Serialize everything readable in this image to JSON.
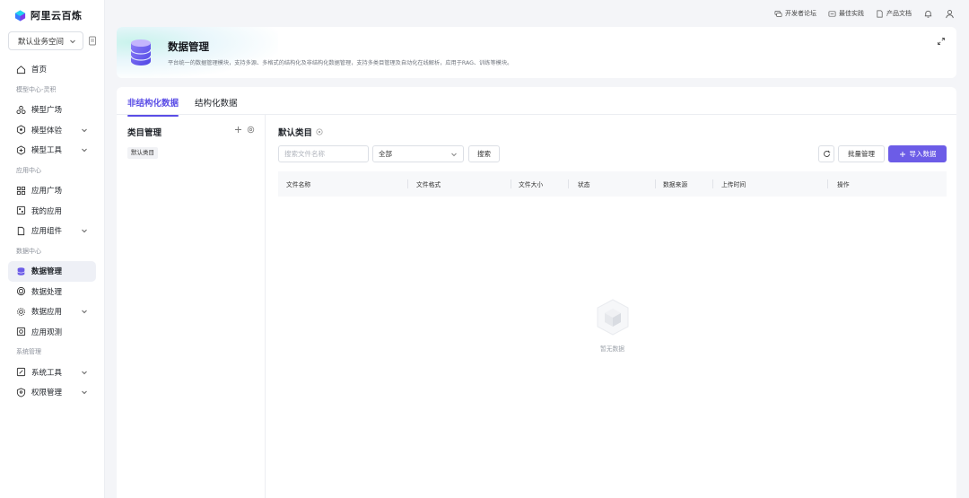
{
  "brand": {
    "name": "阿里云百炼"
  },
  "workspace": {
    "selected": "默认业务空间"
  },
  "nav": {
    "home": "首页",
    "group_model": "模型中心-灵积",
    "model_square": "模型广场",
    "model_experience": "模型体验",
    "model_tools": "模型工具",
    "group_app": "应用中心",
    "app_square": "应用广场",
    "my_apps": "我的应用",
    "app_components": "应用组件",
    "group_data": "数据中心",
    "data_management": "数据管理",
    "data_processing": "数据处理",
    "data_apps": "数据应用",
    "app_observation": "应用观测",
    "group_system": "系统管理",
    "system_tools": "系统工具",
    "permission_management": "权限管理"
  },
  "topbar": {
    "dev_forum": "开发者论坛",
    "best_practice": "最佳实践",
    "product_docs": "产品文档"
  },
  "hero": {
    "title": "数据管理",
    "description": "平台统一的数据管理模块，支持多源、多格式的结构化及非结构化数据管理，支持多类目管理及自动化在线解析，应用于RAG、训练等模块。"
  },
  "tabs": {
    "unstructured": "非结构化数据",
    "structured": "结构化数据"
  },
  "category": {
    "title": "类目管理",
    "default_item": "默认类目"
  },
  "list": {
    "title": "默认类目",
    "search_placeholder": "搜索文件名称",
    "filter_value": "全部",
    "search_button": "搜索",
    "batch_button": "批量管理",
    "import_button": "导入数据",
    "columns": [
      "文件名称",
      "文件格式",
      "文件大小",
      "状态",
      "数据来源",
      "上传时间",
      "操作"
    ],
    "empty_text": "暂无数据"
  },
  "colors": {
    "accent": "#6c5ce7",
    "active_tab": "#5a4de6"
  }
}
